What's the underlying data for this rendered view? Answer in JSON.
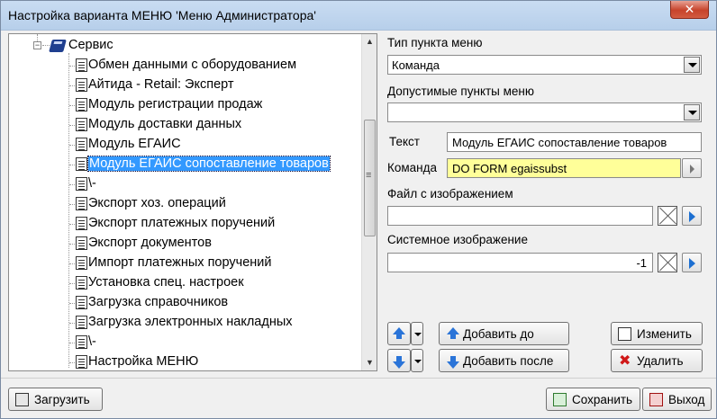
{
  "window": {
    "title": "Настройка варианта МЕНЮ 'Меню Администратора'",
    "close_label": "✕"
  },
  "tree": {
    "root_label": "Сервис",
    "root_expander": "−",
    "items": [
      {
        "label": "Обмен данными с оборудованием"
      },
      {
        "label": "Айтида - Retail: Эксперт"
      },
      {
        "label": "Модуль регистрации продаж"
      },
      {
        "label": "Модуль доставки данных"
      },
      {
        "label": "Модуль ЕГАИС"
      },
      {
        "label": "Модуль ЕГАИС сопоставление товаров",
        "selected": true
      },
      {
        "label": "\\-"
      },
      {
        "label": "Экспорт хоз. операций"
      },
      {
        "label": "Экспорт платежных поручений"
      },
      {
        "label": "Экспорт документов"
      },
      {
        "label": "Импорт платежных поручений"
      },
      {
        "label": "Установка спец. настроек"
      },
      {
        "label": "Загрузка справочников"
      },
      {
        "label": "Загрузка электронных накладных"
      },
      {
        "label": "\\-"
      },
      {
        "label": "Настройка МЕНЮ"
      }
    ]
  },
  "form": {
    "menu_type_label": "Тип пункта меню",
    "menu_type_value": "Команда",
    "allowed_items_label": "Допустимые пункты меню",
    "allowed_items_value": "",
    "text_label": "Текст",
    "text_value": "Модуль ЕГАИС сопоставление товаров",
    "command_label": "Команда",
    "command_value": "DO FORM egaissubst",
    "image_file_label": "Файл с изображением",
    "image_file_value": "",
    "system_image_label": "Системное изображение",
    "system_image_value": "-1"
  },
  "buttons": {
    "add_before": "Добавить до",
    "add_after": "Добавить после",
    "edit": "Изменить",
    "delete": "Удалить",
    "load": "Загрузить",
    "save": "Сохранить",
    "exit": "Выход"
  },
  "colors": {
    "selection": "#3399ff",
    "command_highlight": "#ffff99",
    "accent_blue": "#2a74d8"
  }
}
